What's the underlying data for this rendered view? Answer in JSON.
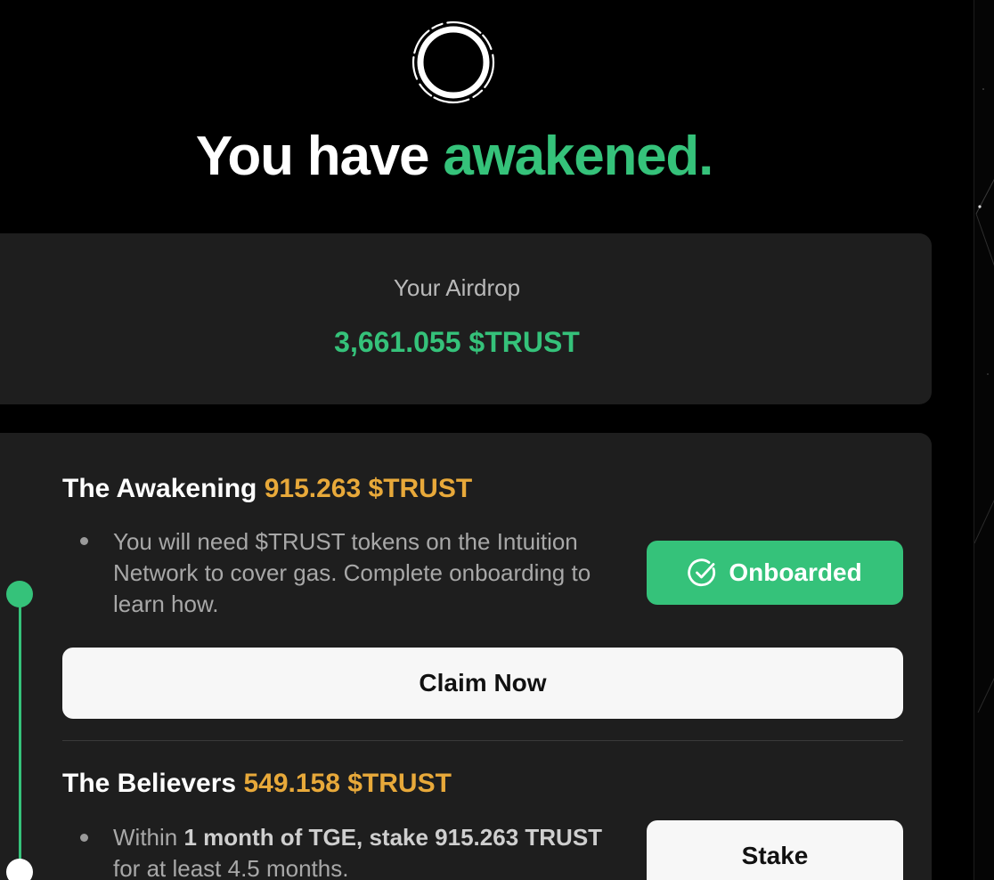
{
  "header": {
    "title_prefix": "You have ",
    "title_accent": "awakened."
  },
  "airdrop": {
    "label": "Your Airdrop",
    "amount": "3,661.055 $TRUST"
  },
  "phases": [
    {
      "title": "The Awakening",
      "reward": "915.263 $TRUST",
      "description": "You will need $TRUST tokens on the Intuition Network to cover gas. Complete onboarding to learn how.",
      "status_button": "Onboarded",
      "action_button": "Claim Now"
    },
    {
      "title": "The Believers",
      "reward": "549.158 $TRUST",
      "description_pre": "Within ",
      "description_bold": "1 month of TGE, stake 915.263 TRUST",
      "description_post": " for at least 4.5 months.",
      "action_button": "Stake"
    }
  ],
  "colors": {
    "accent_green": "#35c27a",
    "reward_gold": "#e8a93a",
    "card_bg": "#1e1e1e"
  },
  "icons": {
    "logo": "ring-logo-icon",
    "onboarded": "check-circle-icon"
  }
}
